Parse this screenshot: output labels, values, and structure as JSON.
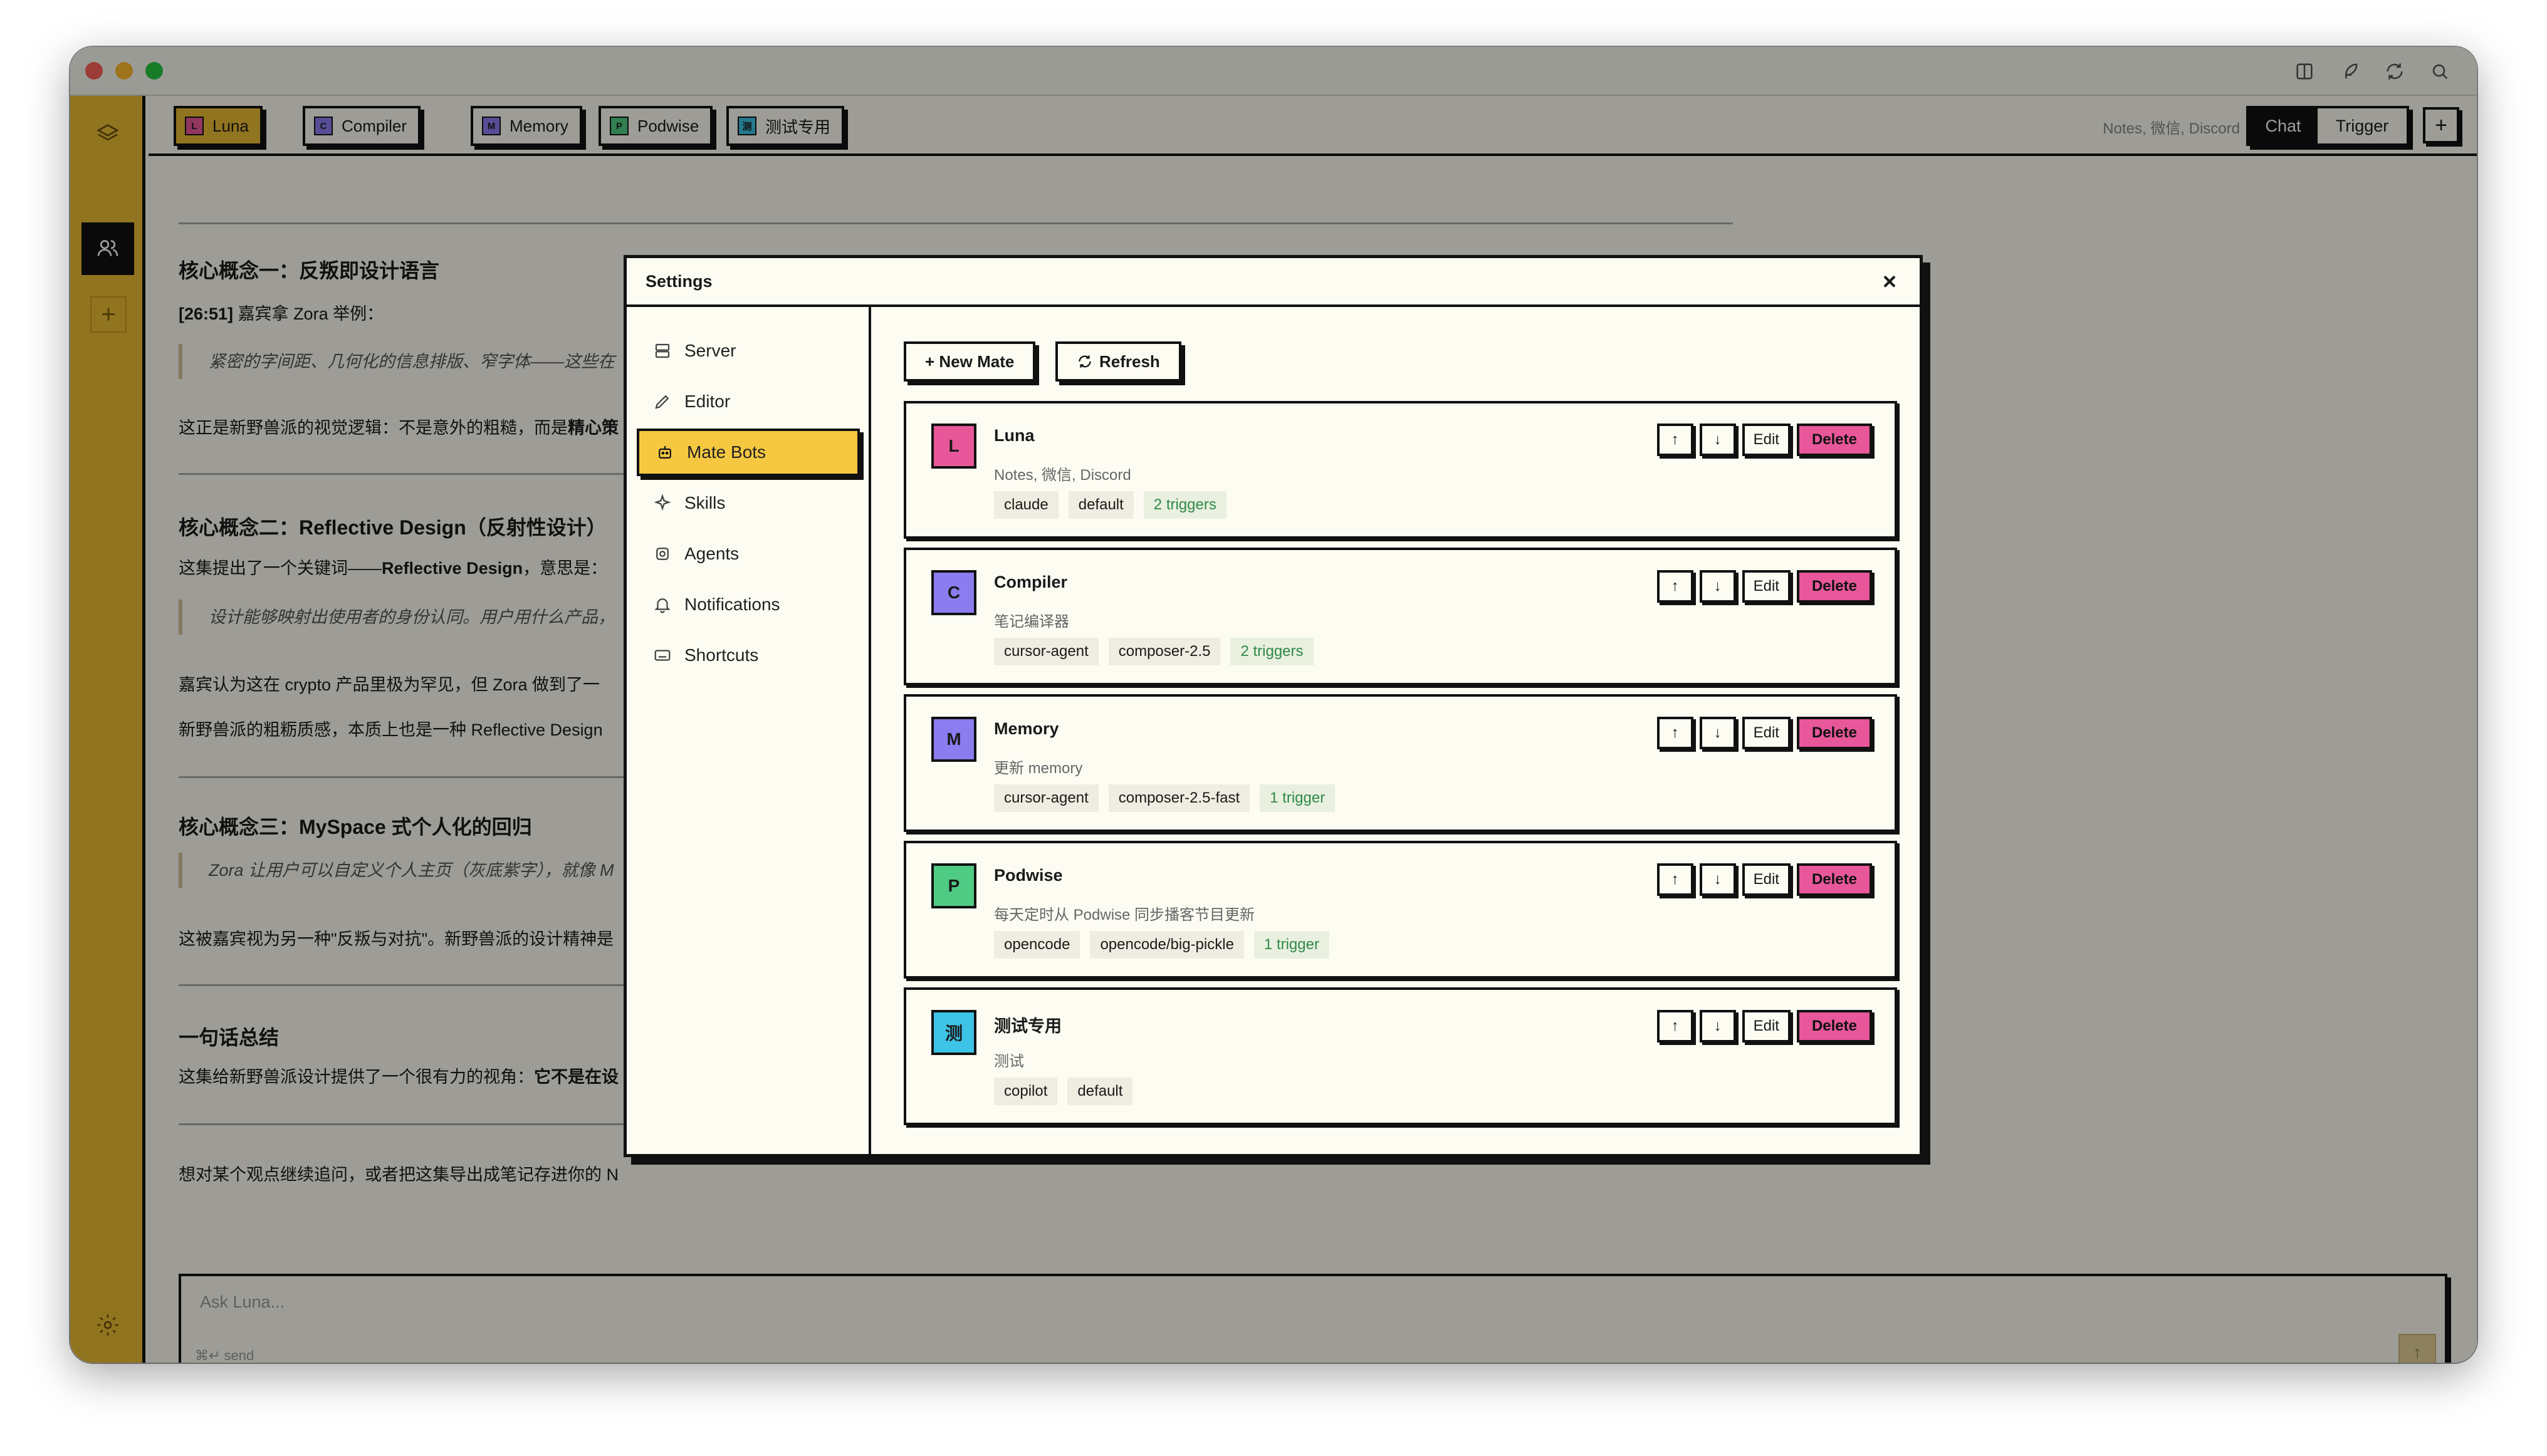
{
  "colors": {
    "sidebar": "#ebbc33",
    "accent": "#f6c842",
    "delete": "#e8579a",
    "trigger_text": "#2f8a49",
    "ink": "#111111",
    "paper": "#fdfcf3"
  },
  "tabs": [
    {
      "initial": "L",
      "label": "Luna",
      "color": "#e8579a",
      "active": true
    },
    {
      "initial": "C",
      "label": "Compiler",
      "color": "#8b7cf0",
      "active": false
    },
    {
      "initial": "M",
      "label": "Memory",
      "color": "#8b7cf0",
      "active": false
    },
    {
      "initial": "P",
      "label": "Podwise",
      "color": "#4fcb84",
      "active": false
    },
    {
      "initial": "测",
      "label": "测试专用",
      "color": "#3cc3e6",
      "active": false
    }
  ],
  "topbar": {
    "channels": "Notes, 微信, Discord",
    "mode_chat": "Chat",
    "mode_trigger": "Trigger",
    "add": "+"
  },
  "sidebar": {
    "add": "+"
  },
  "article": {
    "h1": "核心概念一：反叛即设计语言",
    "p1_ts": "[26:51]",
    "p1": "嘉宾拿 Zora 举例：",
    "q1": "紧密的字间距、几何化的信息排版、窄字体——这些在",
    "p2a": "这正是新野兽派的视觉逻辑：不是意外的粗糙，而是",
    "p2b": "精心策",
    "h2": "核心概念二：Reflective Design（反射性设计）",
    "p3a": "这集提出了一个关键词——",
    "p3b": "Reflective Design",
    "p3c": "，意思是：",
    "q2": "设计能够映射出使用者的身份认同。用户用什么产品，",
    "p4": "嘉宾认为这在 crypto 产品里极为罕见，但 Zora 做到了一",
    "p5": "新野兽派的粗粝质感，本质上也是一种 Reflective Design",
    "h3": "核心概念三：MySpace 式个人化的回归",
    "q3": "Zora 让用户可以自定义个人主页（灰底紫字），就像 M",
    "p6": "这被嘉宾视为另一种\"反叛与对抗\"。新野兽派的设计精神是",
    "h4": "一句话总结",
    "p7a": "这集给新野兽派设计提供了一个很有力的视角：",
    "p7b": "它不是在设",
    "p8": "想对某个观点继续追问，或者把这集导出成笔记存进你的 N"
  },
  "composer": {
    "placeholder": "Ask Luna...",
    "hint": "⌘↵ send",
    "send": "↑"
  },
  "settings": {
    "title": "Settings",
    "close": "×",
    "nav": [
      {
        "label": "Server",
        "icon": "server-icon",
        "active": false
      },
      {
        "label": "Editor",
        "icon": "pencil-icon",
        "active": false
      },
      {
        "label": "Mate Bots",
        "icon": "bot-icon",
        "active": true
      },
      {
        "label": "Skills",
        "icon": "sparkle-icon",
        "active": false
      },
      {
        "label": "Agents",
        "icon": "agent-icon",
        "active": false
      },
      {
        "label": "Notifications",
        "icon": "bell-icon",
        "active": false
      },
      {
        "label": "Shortcuts",
        "icon": "keyboard-icon",
        "active": false
      }
    ],
    "new_mate": "+ New Mate",
    "refresh": "Refresh",
    "up": "↑",
    "down": "↓",
    "edit": "Edit",
    "delete": "Delete",
    "mates": [
      {
        "initial": "L",
        "name": "Luna",
        "desc": "Notes, 微信, Discord",
        "color": "#e8579a",
        "chips": [
          "claude",
          "default"
        ],
        "trigger": "2 triggers"
      },
      {
        "initial": "C",
        "name": "Compiler",
        "desc": "笔记编译器",
        "color": "#8b7cf0",
        "chips": [
          "cursor-agent",
          "composer-2.5"
        ],
        "trigger": "2 triggers"
      },
      {
        "initial": "M",
        "name": "Memory",
        "desc": "更新 memory",
        "color": "#8b7cf0",
        "chips": [
          "cursor-agent",
          "composer-2.5-fast"
        ],
        "trigger": "1 trigger"
      },
      {
        "initial": "P",
        "name": "Podwise",
        "desc": "每天定时从 Podwise 同步播客节目更新",
        "color": "#4fcb84",
        "chips": [
          "opencode",
          "opencode/big-pickle"
        ],
        "trigger": "1 trigger"
      },
      {
        "initial": "测",
        "name": "测试专用",
        "desc": "测试",
        "color": "#3cc3e6",
        "chips": [
          "copilot",
          "default"
        ],
        "trigger": ""
      }
    ]
  }
}
